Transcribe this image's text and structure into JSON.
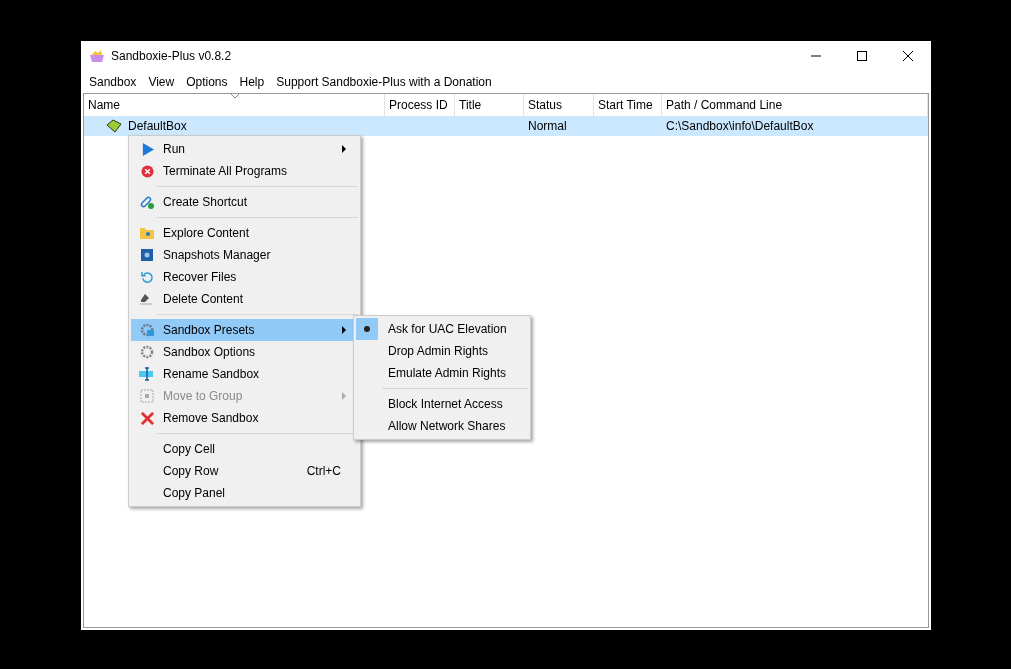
{
  "window": {
    "title": "Sandboxie-Plus v0.8.2"
  },
  "menu_bar": [
    "Sandbox",
    "View",
    "Options",
    "Help",
    "Support Sandboxie-Plus with a Donation"
  ],
  "table": {
    "columns": [
      "Name",
      "Process ID",
      "Title",
      "Status",
      "Start Time",
      "Path / Command Line"
    ],
    "rows": [
      {
        "name": "DefaultBox",
        "status": "Normal",
        "path": "C:\\Sandbox\\info\\DefaultBox",
        "selected": true
      }
    ]
  },
  "context_menu": {
    "items": [
      {
        "kind": "item",
        "label": "Run",
        "submenu": true,
        "disabled": false,
        "selected": false
      },
      {
        "kind": "item",
        "label": "Terminate All Programs",
        "disabled": false,
        "selected": false
      },
      {
        "kind": "separator"
      },
      {
        "kind": "item",
        "label": "Create Shortcut",
        "disabled": false,
        "selected": false
      },
      {
        "kind": "separator"
      },
      {
        "kind": "item",
        "label": "Explore Content",
        "disabled": false,
        "selected": false
      },
      {
        "kind": "item",
        "label": "Snapshots Manager",
        "disabled": false,
        "selected": false
      },
      {
        "kind": "item",
        "label": "Recover Files",
        "disabled": false,
        "selected": false
      },
      {
        "kind": "item",
        "label": "Delete Content",
        "disabled": false,
        "selected": false
      },
      {
        "kind": "separator"
      },
      {
        "kind": "item",
        "label": "Sandbox Presets",
        "submenu": true,
        "disabled": false,
        "selected": true
      },
      {
        "kind": "item",
        "label": "Sandbox Options",
        "disabled": false,
        "selected": false
      },
      {
        "kind": "item",
        "label": "Rename Sandbox",
        "disabled": false,
        "selected": false
      },
      {
        "kind": "item",
        "label": "Move to Group",
        "submenu": true,
        "disabled": true,
        "selected": false
      },
      {
        "kind": "item",
        "label": "Remove Sandbox",
        "disabled": false,
        "selected": false
      },
      {
        "kind": "separator"
      },
      {
        "kind": "item",
        "label": "Copy Cell",
        "disabled": false,
        "selected": false
      },
      {
        "kind": "item",
        "label": "Copy Row",
        "shortcut": "Ctrl+C",
        "disabled": false,
        "selected": false
      },
      {
        "kind": "item",
        "label": "Copy Panel",
        "disabled": false,
        "selected": false
      }
    ]
  },
  "submenu": {
    "items": [
      {
        "kind": "item",
        "label": "Ask for UAC Elevation",
        "checked": true
      },
      {
        "kind": "item",
        "label": "Drop Admin Rights",
        "checked": false
      },
      {
        "kind": "item",
        "label": "Emulate Admin Rights",
        "checked": false
      },
      {
        "kind": "separator"
      },
      {
        "kind": "item",
        "label": "Block Internet Access",
        "checked": false
      },
      {
        "kind": "item",
        "label": "Allow Network Shares",
        "checked": false
      }
    ]
  }
}
